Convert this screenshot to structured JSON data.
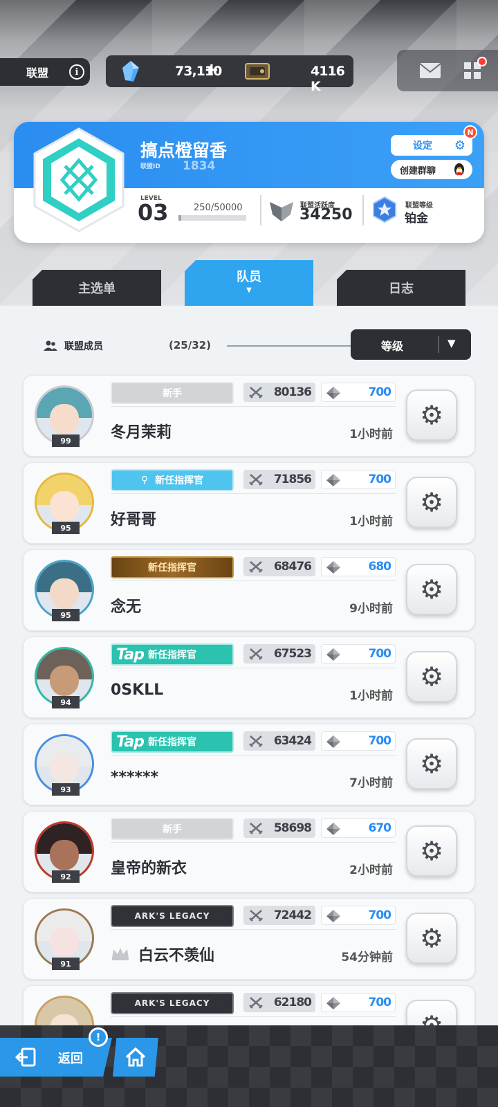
{
  "topbar": {
    "alliance_label": "联盟",
    "info_icon": "i",
    "crystal_amount": "73,110",
    "plus": "+",
    "ticket_amount": "4116 K"
  },
  "card": {
    "name": "搞点橙留香",
    "id_label": "联盟ID",
    "id_value": "1834",
    "settings_label": "设定",
    "new_badge": "N",
    "chat_label": "创建群聊",
    "level_label": "LEVEL",
    "level_value": "03",
    "exp_text": "250/50000",
    "exp_progress": 0.005,
    "activity_label": "联盟活跃度",
    "activity_value": "34250",
    "rank_label": "联盟等级",
    "rank_value": "铂金"
  },
  "tabs": {
    "main": "主选单",
    "members": "队员",
    "log": "日志"
  },
  "list": {
    "members_label": "联盟成员",
    "members_count": "(25/32)",
    "sort_label": "等级",
    "rows": [
      {
        "name": "冬月茉莉",
        "level": "99",
        "title": "新手",
        "title_style": "newbie",
        "power": "80136",
        "contribution": "700",
        "time": "1小时前"
      },
      {
        "name": "好哥哥",
        "level": "95",
        "title": "新任指挥官",
        "title_style": "blue",
        "power": "71856",
        "contribution": "700",
        "time": "1小时前"
      },
      {
        "name": "念无",
        "level": "95",
        "title": "新任指挥官",
        "title_style": "gold",
        "power": "68476",
        "contribution": "680",
        "time": "9小时前"
      },
      {
        "name": "0SKLL",
        "level": "94",
        "title": "新任指挥官",
        "title_style": "tap",
        "power": "67523",
        "contribution": "700",
        "time": "1小时前"
      },
      {
        "name": "******",
        "level": "93",
        "title": "新任指挥官",
        "title_style": "tap",
        "power": "63424",
        "contribution": "700",
        "time": "7小时前"
      },
      {
        "name": "皇帝的新衣",
        "level": "92",
        "title": "新手",
        "title_style": "newbie",
        "power": "58698",
        "contribution": "670",
        "time": "2小时前"
      },
      {
        "name": "白云不羡仙",
        "level": "91",
        "title": "ARK'S LEGACY",
        "title_style": "ark",
        "power": "72442",
        "contribution": "700",
        "time": "54分钟前",
        "leader": true
      },
      {
        "name": "",
        "level": "",
        "title": "ARK'S LEGACY",
        "title_style": "ark",
        "power": "62180",
        "contribution": "700",
        "time": ""
      }
    ]
  },
  "bottom": {
    "back_label": "返回",
    "alert": "!"
  }
}
